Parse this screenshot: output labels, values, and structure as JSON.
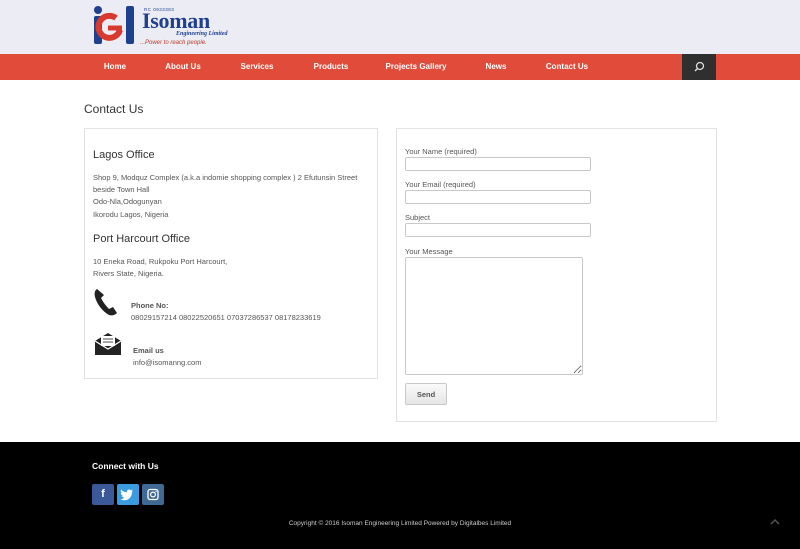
{
  "brand": {
    "name": "Isoman",
    "rc_number": "RC 0933383",
    "sub": "Engineering Limited",
    "tagline": "...Power to reach people."
  },
  "nav": {
    "items": [
      "Home",
      "About Us",
      "Services",
      "Products",
      "Projects Gallery",
      "News",
      "Contact Us"
    ]
  },
  "page": {
    "title": "Contact Us"
  },
  "offices": [
    {
      "title": "Lagos Office",
      "lines": [
        "Shop 9, Modquz Complex (a.k.a indomie shopping complex ) 2 Efutunsin Street",
        "beside Town Hall",
        "Odo-Nla,Odogunyan",
        "Ikorodu Lagos, Nigeria"
      ]
    },
    {
      "title": "Port Harcourt Office",
      "lines": [
        "10 Eneka Road, Rukpoku Port Harcourt,",
        "Rivers State, Nigeria."
      ]
    }
  ],
  "contact": {
    "phone_label": "Phone No:",
    "phone_value": "08029157214 08022520651 07037286537 08178233619",
    "email_label": "Email us",
    "email_value": "info@isomanng.com"
  },
  "form": {
    "name_label": "Your Name (required)",
    "email_label": "Your Email (required)",
    "subject_label": "Subject",
    "message_label": "Your Message",
    "send_label": "Send"
  },
  "footer": {
    "connect_title": "Connect with Us",
    "social": [
      {
        "icon": "facebook-icon",
        "glyph": "f",
        "color": "#3b5998"
      },
      {
        "icon": "twitter-icon",
        "glyph": "t",
        "color": "#3a9be0"
      },
      {
        "icon": "instagram-icon",
        "glyph": "◎",
        "color": "#3f6a93"
      }
    ],
    "copyright": "Copyright © 2016 Isoman Engineering Limited Powered by Digitalbes Limited"
  },
  "colors": {
    "accent": "#e04b3a",
    "brand_blue": "#1f3f8f",
    "footer_bg": "#000000"
  }
}
